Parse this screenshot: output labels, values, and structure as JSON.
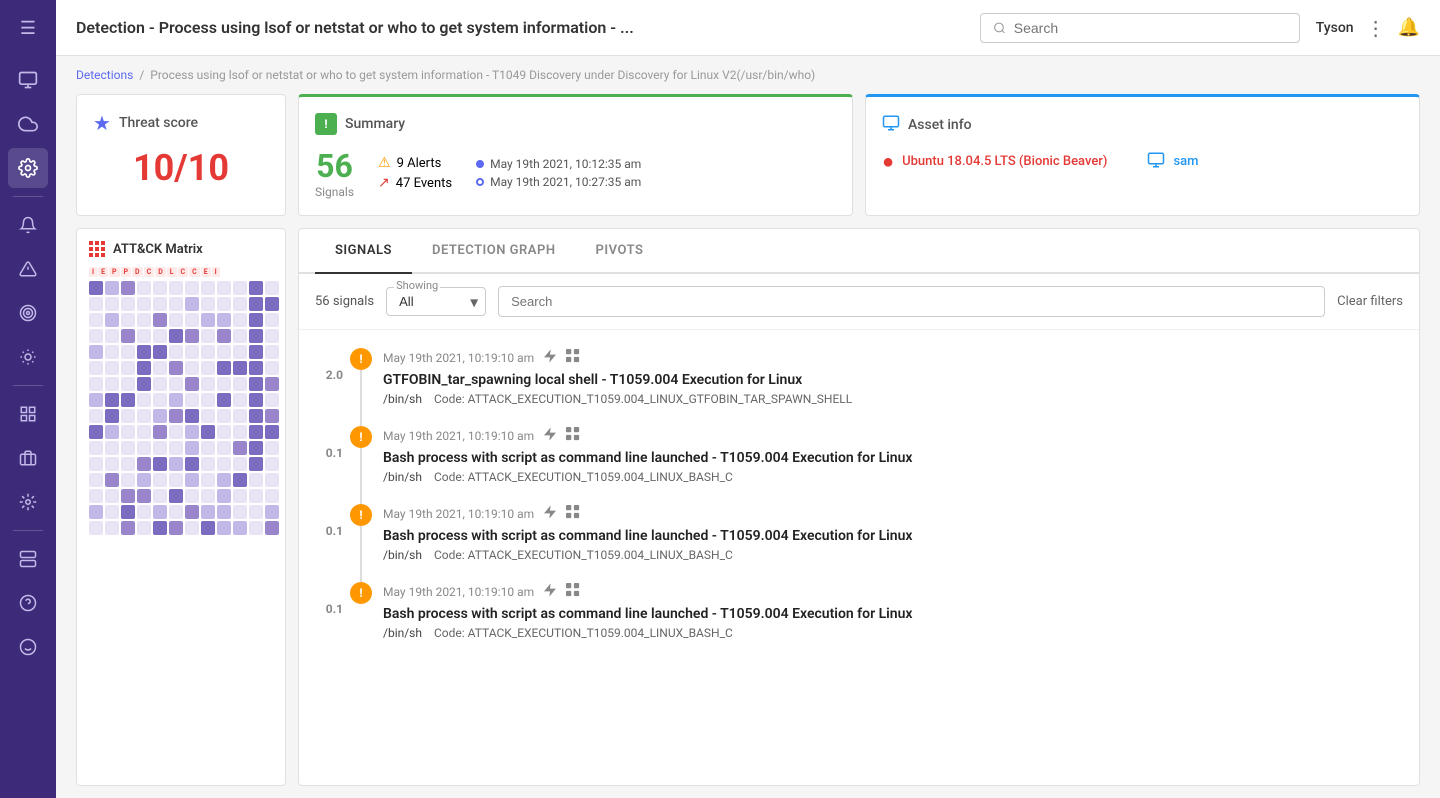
{
  "sidebar": {
    "items": [
      {
        "name": "menu-icon",
        "icon": "☰",
        "active": false
      },
      {
        "name": "monitor-icon",
        "icon": "🖥",
        "active": false
      },
      {
        "name": "cloud-icon",
        "icon": "☁",
        "active": false
      },
      {
        "name": "gear-flower-icon",
        "icon": "✦",
        "active": true
      },
      {
        "name": "bell-icon",
        "icon": "🔔",
        "active": false
      },
      {
        "name": "alert-icon",
        "icon": "⚠",
        "active": false
      },
      {
        "name": "target-icon",
        "icon": "◎",
        "active": false
      },
      {
        "name": "weather-icon",
        "icon": "⛅",
        "active": false
      },
      {
        "name": "chart-icon",
        "icon": "▦",
        "active": false
      },
      {
        "name": "building-icon",
        "icon": "🏢",
        "active": false
      },
      {
        "name": "settings-icon",
        "icon": "⚙",
        "active": false
      },
      {
        "name": "server-icon",
        "icon": "▣",
        "active": false
      },
      {
        "name": "help-icon",
        "icon": "?",
        "active": false
      },
      {
        "name": "face-icon",
        "icon": "☺",
        "active": false
      }
    ]
  },
  "topbar": {
    "title": "Detection - Process using lsof or netstat or who to get system information - ...",
    "search_placeholder": "Search",
    "user": "Tyson"
  },
  "breadcrumb": {
    "root": "Detections",
    "separator": "/",
    "current": "Process using lsof or netstat or who to get system information - T1049 Discovery under Discovery for Linux V2(/usr/bin/who)"
  },
  "threat_score": {
    "label": "Threat score",
    "value": "10/10"
  },
  "summary": {
    "label": "Summary",
    "signals_count": "56",
    "signals_label": "Signals",
    "alerts_count": "9 Alerts",
    "events_count": "47 Events",
    "date_start": "May 19th 2021, 10:12:35 am",
    "date_end": "May 19th 2021, 10:27:35 am"
  },
  "asset_info": {
    "label": "Asset info",
    "os_name": "Ubuntu 18.04.5 LTS (Bionic Beaver)",
    "computer_name": "sam"
  },
  "attack_matrix": {
    "title": "ATT&CK Matrix",
    "labels": [
      "I",
      "E",
      "P",
      "P",
      "D",
      "C",
      "D",
      "L",
      "C",
      "C",
      "E",
      "I"
    ]
  },
  "tabs": [
    {
      "label": "SIGNALS",
      "active": true
    },
    {
      "label": "DETECTION GRAPH",
      "active": false
    },
    {
      "label": "PIVOTS",
      "active": false
    }
  ],
  "filter": {
    "count": "56 signals",
    "showing_label": "Showing",
    "showing_value": "All",
    "search_placeholder": "Search",
    "clear_label": "Clear filters"
  },
  "signals": [
    {
      "score": "2.0",
      "time": "May 19th 2021, 10:19:10 am",
      "title": "GTFOBIN_tar_spawning local shell - T1059.004 Execution for Linux",
      "path": "/bin/sh",
      "code": "Code: ATTACK_EXECUTION_T1059.004_LINUX_GTFOBIN_TAR_SPAWN_SHELL",
      "dot_color": "orange",
      "is_high": true
    },
    {
      "score": "0.1",
      "time": "May 19th 2021, 10:19:10 am",
      "title": "Bash process with script as command line launched - T1059.004 Execution for Linux",
      "path": "/bin/sh",
      "code": "Code: ATTACK_EXECUTION_T1059.004_LINUX_BASH_C",
      "dot_color": "orange",
      "is_high": false
    },
    {
      "score": "0.1",
      "time": "May 19th 2021, 10:19:10 am",
      "title": "Bash process with script as command line launched - T1059.004 Execution for Linux",
      "path": "/bin/sh",
      "code": "Code: ATTACK_EXECUTION_T1059.004_LINUX_BASH_C",
      "dot_color": "orange",
      "is_high": false
    },
    {
      "score": "0.1",
      "time": "May 19th 2021, 10:19:10 am",
      "title": "Bash process with script as command line launched - T1059.004 Execution for Linux",
      "path": "/bin/sh",
      "code": "Code: ATTACK_EXECUTION_T1059.004_LINUX_BASH_C",
      "dot_color": "orange",
      "is_high": false
    }
  ]
}
